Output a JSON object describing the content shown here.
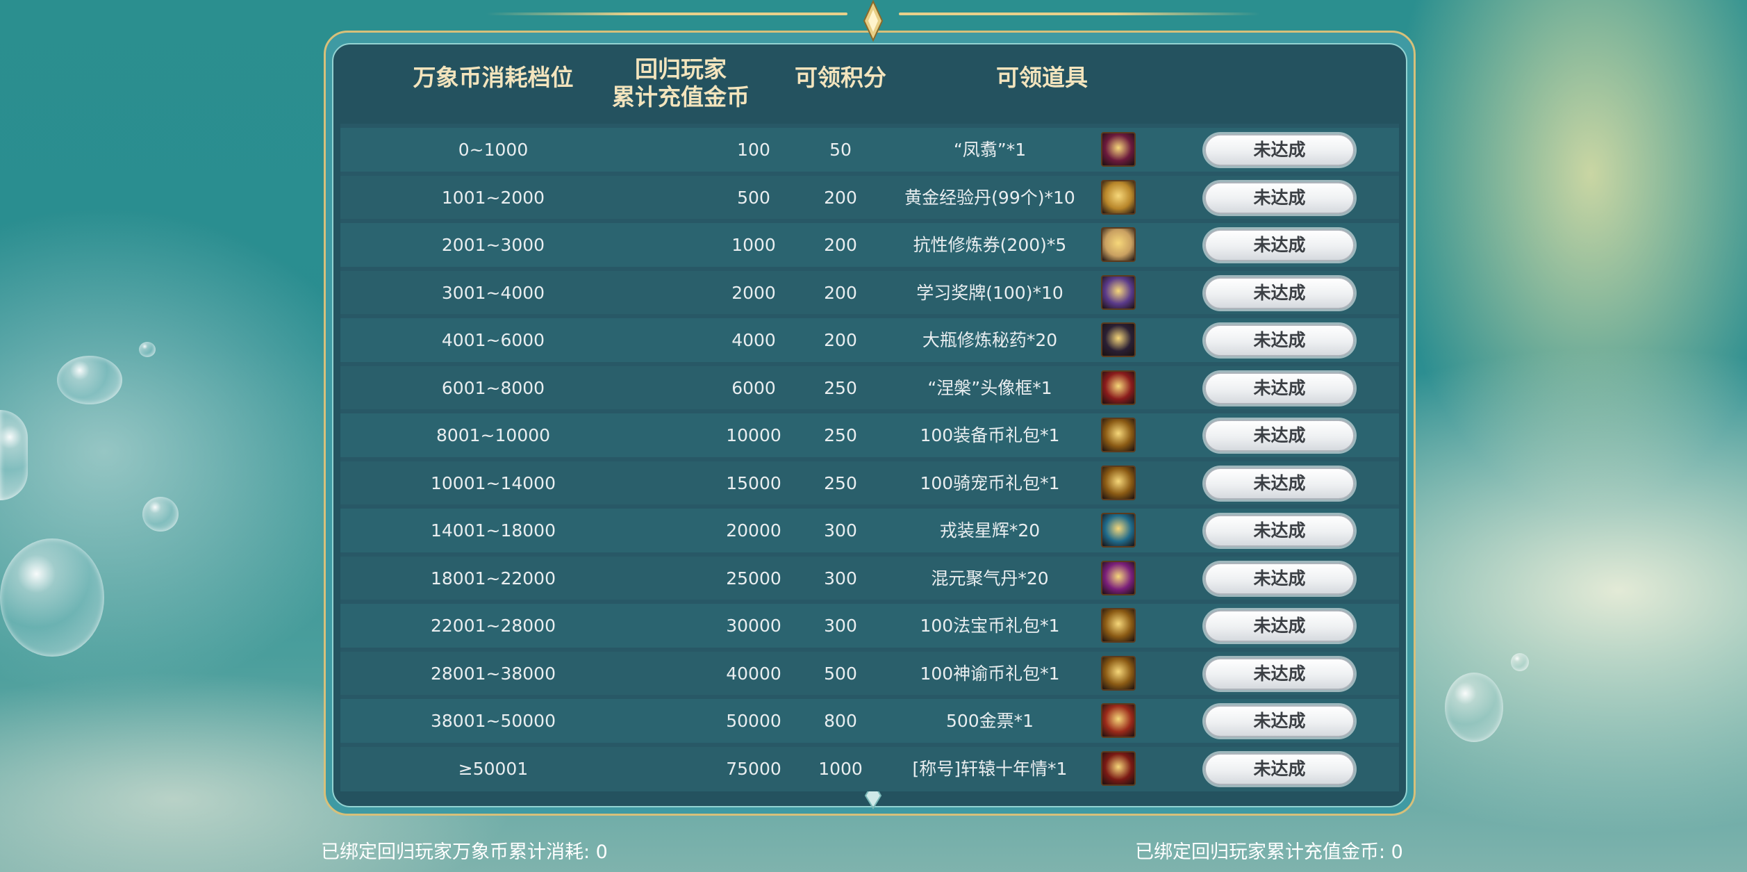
{
  "header": {
    "col_tier": "万象币消耗档位",
    "col_recharge_line1": "回归玩家",
    "col_recharge_line2": "累计充值金币",
    "col_points": "可领积分",
    "col_items": "可领道具"
  },
  "rows": [
    {
      "tier": "0~1000",
      "recharge": "100",
      "points": "50",
      "item": "“凤翥”*1",
      "icon": "fengzhu-token-icon",
      "icon_color": "#6b1a3c",
      "status": "未达成"
    },
    {
      "tier": "1001~2000",
      "recharge": "500",
      "points": "200",
      "item": "黄金经验丹(99个)*10",
      "icon": "gold-exp-pill-icon",
      "icon_color": "#b8862a",
      "status": "未达成"
    },
    {
      "tier": "2001~3000",
      "recharge": "1000",
      "points": "200",
      "item": "抗性修炼券(200)*5",
      "icon": "scroll-icon",
      "icon_color": "#c9a061",
      "status": "未达成"
    },
    {
      "tier": "3001~4000",
      "recharge": "2000",
      "points": "200",
      "item": "学习奖牌(100)*10",
      "icon": "medal-icon",
      "icon_color": "#5a3a8a",
      "status": "未达成"
    },
    {
      "tier": "4001~6000",
      "recharge": "4000",
      "points": "200",
      "item": "大瓶修炼秘药*20",
      "icon": "potion-bottle-icon",
      "icon_color": "#2a1f33",
      "status": "未达成"
    },
    {
      "tier": "6001~8000",
      "recharge": "6000",
      "points": "250",
      "item": "“涅槃”头像框*1",
      "icon": "avatar-frame-icon",
      "icon_color": "#8a1c1c",
      "status": "未达成"
    },
    {
      "tier": "8001~10000",
      "recharge": "10000",
      "points": "250",
      "item": "100装备币礼包*1",
      "icon": "equip-coin-pack-icon",
      "icon_color": "#8a5a14",
      "status": "未达成"
    },
    {
      "tier": "10001~14000",
      "recharge": "15000",
      "points": "250",
      "item": "100骑宠币礼包*1",
      "icon": "mount-coin-pack-icon",
      "icon_color": "#8a5a14",
      "status": "未达成"
    },
    {
      "tier": "14001~18000",
      "recharge": "20000",
      "points": "300",
      "item": "戎装星辉*20",
      "icon": "crystal-icon",
      "icon_color": "#1f6a8a",
      "status": "未达成"
    },
    {
      "tier": "18001~22000",
      "recharge": "25000",
      "points": "300",
      "item": "混元聚气丹*20",
      "icon": "orb-icon",
      "icon_color": "#7a1f7a",
      "status": "未达成"
    },
    {
      "tier": "22001~28000",
      "recharge": "30000",
      "points": "300",
      "item": "100法宝币礼包*1",
      "icon": "treasure-coin-pack-icon",
      "icon_color": "#8a5a14",
      "status": "未达成"
    },
    {
      "tier": "28001~38000",
      "recharge": "40000",
      "points": "500",
      "item": "100神谕币礼包*1",
      "icon": "oracle-coin-pack-icon",
      "icon_color": "#8a5a14",
      "status": "未达成"
    },
    {
      "tier": "38001~50000",
      "recharge": "50000",
      "points": "800",
      "item": "500金票*1",
      "icon": "gold-ticket-icon",
      "icon_color": "#9a2a1a",
      "status": "未达成"
    },
    {
      "tier": "≥50001",
      "recharge": "75000",
      "points": "1000",
      "item": "[称号]轩辕十年情*1",
      "icon": "title-badge-icon",
      "icon_color": "#7a1a14",
      "status": "未达成"
    }
  ],
  "footer": {
    "left": "已绑定回归玩家万象币累计消耗: 0",
    "right": "已绑定回归玩家累计充值金币: 0"
  }
}
